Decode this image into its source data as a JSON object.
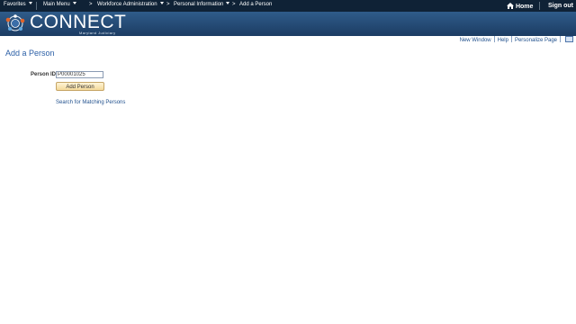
{
  "topnav": {
    "favorites": "Favorites",
    "main_menu": "Main Menu",
    "crumb_sep": ">",
    "workforce": "Workforce Administration",
    "personal_info": "Personal Information",
    "current": "Add a Person",
    "home": "Home",
    "signout": "Sign out"
  },
  "banner": {
    "logo_text": "CONNECT",
    "logo_sub": "Maryland Judiciary"
  },
  "utility": {
    "new_window": "New Window",
    "help": "Help",
    "personalize": "Personalize Page"
  },
  "page": {
    "title": "Add a Person",
    "person_id_label": "Person ID",
    "person_id_value": "P00001025",
    "add_button": "Add Person",
    "search_link": "Search for Matching Persons"
  },
  "colors": {
    "topnav_bg": "#0f2236",
    "banner": "#2f5c8a",
    "link": "#1f4f8c",
    "title": "#2b5fa6",
    "button": "#f4d99a"
  }
}
